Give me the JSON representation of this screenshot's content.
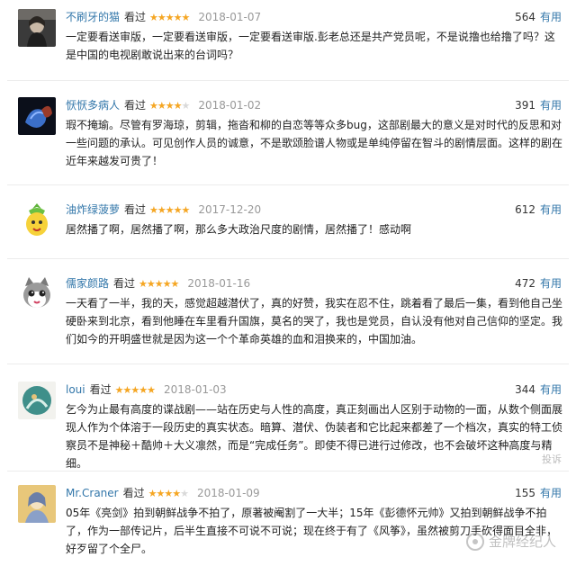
{
  "reviews": [
    {
      "username": "不刷牙的猫",
      "status": "看过",
      "rating": 5,
      "stars_text": "★★★★★",
      "date": "2018-01-07",
      "votes": "564",
      "useful_label": "有用",
      "text": "一定要看送审版，一定要看送审版，一定要看送审版.彭老总还是共产党员呢，不是说撸也给撸了吗？这是中国的电视剧敢说出来的台词吗？",
      "avatar": "photo-dark-portrait"
    },
    {
      "username": "恹恹多病人",
      "status": "看过",
      "rating": 4,
      "stars_text": "★★★★",
      "stars_off": "★",
      "date": "2018-01-02",
      "votes": "391",
      "useful_label": "有用",
      "text": "瑕不掩瑜。尽管有罗海琼，剪辑，拖沓和柳的自恋等等众多bug，这部剧最大的意义是对时代的反思和对一些问题的承认。可见创作人员的诚意，不是歌颂脸谱人物或是单纯停留在智斗的剧情层面。这样的剧在近年来越发可贵了！",
      "avatar": "betta-fish"
    },
    {
      "username": "油炸绿菠萝",
      "status": "看过",
      "rating": 5,
      "stars_text": "★★★★★",
      "date": "2017-12-20",
      "votes": "612",
      "useful_label": "有用",
      "text": "居然播了啊，居然播了啊，那么多大政治尺度的剧情，居然播了！感动啊",
      "avatar": "cartoon-pineapple"
    },
    {
      "username": "儒家颜路",
      "status": "看过",
      "rating": 5,
      "stars_text": "★★★★★",
      "date": "2018-01-16",
      "votes": "472",
      "useful_label": "有用",
      "text": "一天看了一半，我的天，感觉超越潜伏了，真的好赞，我实在忍不住，跳着看了最后一集，看到他自己坐硬卧来到北京，看到他睡在车里看升国旗，莫名的哭了，我也是党员，自认没有他对自己信仰的坚定。我们如今的开明盛世就是因为这一个个革命英雄的血和泪换来的，中国加油。",
      "avatar": "cartoon-cat"
    },
    {
      "username": "loui",
      "status": "看过",
      "rating": 5,
      "stars_text": "★★★★★",
      "date": "2018-01-03",
      "votes": "344",
      "useful_label": "有用",
      "text": "乞今为止最有高度的谍战剧——站在历史与人性的高度，真正刻画出人区别于动物的一面，从数个侧面展现人作为个体溶于一段历史的真实状态。暗算、潜伏、伪装者和它比起来都差了一个档次，真实的特工侦察员不是神秘＋酷帅＋大义凛然，而是“完成任务”。即使不得已进行过修改，也不会破坏这种高度与精细。",
      "report_label": "投诉",
      "avatar": "illustration-teal"
    },
    {
      "username": "Mr.Craner",
      "status": "看过",
      "rating": 4,
      "stars_text": "★★★★",
      "stars_off": "★",
      "date": "2018-01-09",
      "votes": "155",
      "useful_label": "有用",
      "text": "05年《亮剑》拍到朝鲜战争不拍了，原著被阉割了一大半；15年《彭德怀元帅》又拍到朝鲜战争不拍了，作为一部传记片，后半生直接不可说不可说；现在终于有了《风筝》，虽然被剪刀手砍得面目全非，好歹留了个全尸。",
      "avatar": "illustration-portrait"
    }
  ],
  "watermark": "金牌经纪人",
  "colors": {
    "link": "#3377aa",
    "star": "#f5a623",
    "muted": "#999999"
  }
}
